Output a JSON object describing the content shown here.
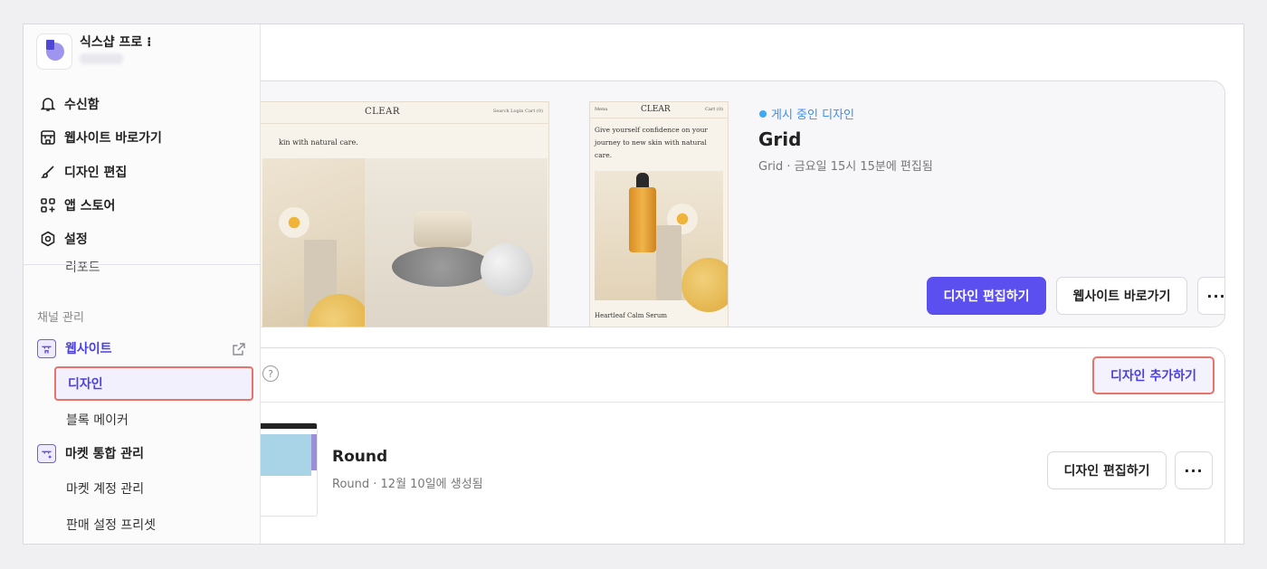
{
  "shop": {
    "name": "식스샵 프로 ⁝",
    "sub": ""
  },
  "menu": {
    "inbox": "수신함",
    "visit_site": "웹사이트 바로가기",
    "edit_design": "디자인 편집",
    "app_store": "앱 스토어",
    "settings": "설정",
    "report": "리포트"
  },
  "channel": {
    "section": "채널 관리",
    "website": "웹사이트",
    "design": "디자인",
    "block_maker": "블록 메이커",
    "market_integration": "마켓 통합 관리",
    "market_accounts": "마켓 계정 관리",
    "sales_preset": "판매 설정 프리셋"
  },
  "published": {
    "status": "게시 중인 디자인",
    "name": "Grid",
    "meta": "Grid · 금요일 15시 15분에 편집됨",
    "edit_button": "디자인 편집하기",
    "visit_button": "웹사이트 바로가기",
    "more_button": "···"
  },
  "preview": {
    "pc_logo": "CLEAR",
    "pc_nav": "Search   Login   Cart (0)",
    "pc_tagline": "kin with natural care.",
    "mobile_menu": "Menu",
    "mobile_logo": "CLEAR",
    "mobile_cart": "Cart (0)",
    "mobile_text": "Give yourself confidence on your journey to new skin with natural care.",
    "mobile_product": "Heartleaf Calm Serum"
  },
  "list": {
    "help": "?",
    "add_button": "디자인 추가하기",
    "items": [
      {
        "name": "Round",
        "meta": "Round  · 12월 10일에 생성됨",
        "edit_button": "디자인 편집하기",
        "more_button": "···"
      }
    ]
  },
  "colors": {
    "accent": "#5b4ff0",
    "highlight": "#e8736a",
    "status": "#3fa8f4"
  }
}
